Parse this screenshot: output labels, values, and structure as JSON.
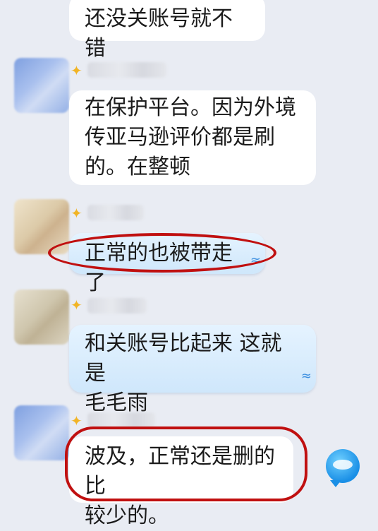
{
  "messages": [
    {
      "text": "还没关账号就不错"
    },
    {
      "lines": [
        "在保护平台。因为外境",
        "传亚马逊评价都是刷",
        "的。在整顿"
      ]
    },
    {
      "text": "正常的也被带走了"
    },
    {
      "lines": [
        "和关账号比起来 这就是",
        "毛毛雨"
      ]
    },
    {
      "lines": [
        "波及，正常还是删的比",
        "较少的。"
      ]
    }
  ],
  "icons": {
    "sparkle": "sparkle-icon",
    "wave": "wave-decoration-icon",
    "bubble_avatar": "chat-bubble-avatar-icon"
  },
  "colors": {
    "background": "#e9ecf3",
    "bubble_white": "#ffffff",
    "bubble_blue": "#d6ebfd",
    "annotation_red": "#c01010",
    "sparkle": "#f1b425"
  }
}
